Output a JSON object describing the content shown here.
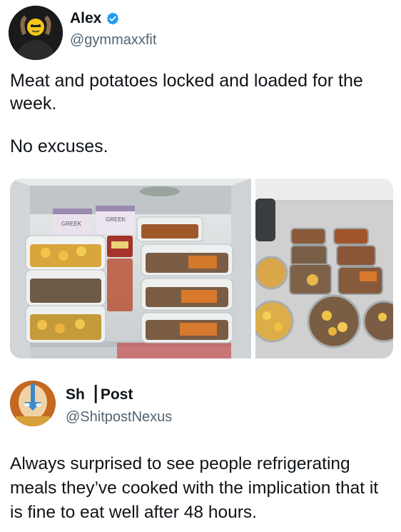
{
  "tweet1": {
    "author_name": "Alex",
    "author_handle": "@gymmaxxfit",
    "text_line1": "Meat and potatoes locked and loaded for the week.",
    "text_line2": "No excuses.",
    "photo1_label": "GREEK",
    "photo1_label2": "GREEK"
  },
  "tweet2": {
    "author_name": "Sh▕ Post",
    "author_handle": "@ShitpostNexus",
    "text": "Always surprised to see people refrigerating meals they’ve cooked with the implication that it is fine to eat well after 48 hours."
  },
  "colors": {
    "verified": "#1d9bf0",
    "handle": "#536471",
    "text": "#0f1419"
  }
}
